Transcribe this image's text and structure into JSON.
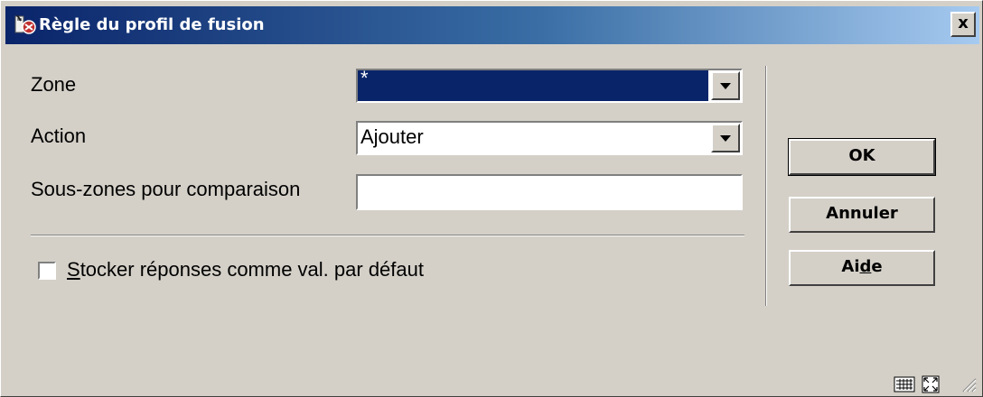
{
  "window": {
    "title": "Règle du profil de fusion",
    "close_label": "x"
  },
  "form": {
    "zone": {
      "label": "Zone",
      "value": "*"
    },
    "action": {
      "label": "Action",
      "value": "Ajouter"
    },
    "sous_zones": {
      "label": "Sous-zones pour comparaison",
      "value": ""
    },
    "stocker": {
      "label_mnemonic": "S",
      "label_rest": "tocker réponses comme val. par défaut",
      "checked": false
    }
  },
  "buttons": {
    "ok": "OK",
    "annuler": "Annuler",
    "aide_before": "Ai",
    "aide_mnemonic": "d",
    "aide_after": "e"
  },
  "icons": {
    "title": "app-icon",
    "keyboard": "keyboard-icon",
    "resize": "maximize-icon",
    "grip": "resize-grip-icon"
  },
  "colors": {
    "title_start": "#0a246a",
    "title_end": "#a6caf0",
    "face": "#d4d0c8",
    "selection": "#0a246a"
  }
}
